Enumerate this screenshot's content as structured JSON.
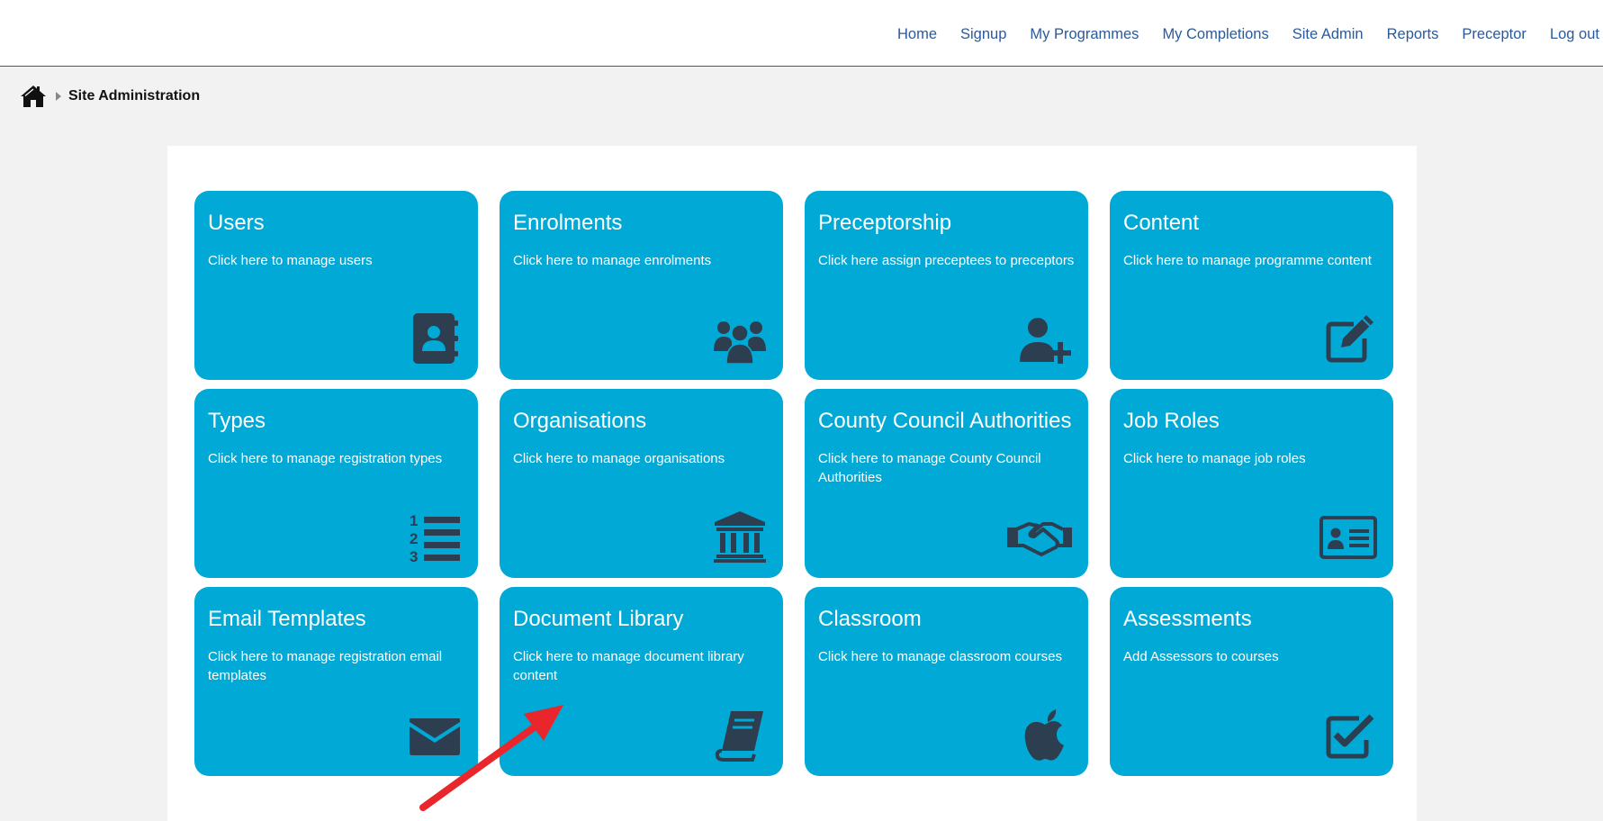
{
  "nav": {
    "items": [
      "Home",
      "Signup",
      "My Programmes",
      "My Completions",
      "Site Admin",
      "Reports",
      "Preceptor",
      "Log out"
    ]
  },
  "breadcrumb": {
    "current": "Site Administration",
    "home_icon": "home-icon"
  },
  "tiles": [
    {
      "title": "Users",
      "desc": "Click here to manage users",
      "icon": "address-book-icon"
    },
    {
      "title": "Enrolments",
      "desc": "Click here to manage enrolments",
      "icon": "users-group-icon"
    },
    {
      "title": "Preceptorship",
      "desc": "Click here assign preceptees to preceptors",
      "icon": "user-plus-icon"
    },
    {
      "title": "Content",
      "desc": "Click here to manage programme content",
      "icon": "edit-icon"
    },
    {
      "title": "Types",
      "desc": "Click here to manage registration types",
      "icon": "numbered-list-icon"
    },
    {
      "title": "Organisations",
      "desc": "Click here to manage organisations",
      "icon": "institution-icon"
    },
    {
      "title": "County Council Authorities",
      "desc": "Click here to manage County Council Authorities",
      "icon": "handshake-icon"
    },
    {
      "title": "Job Roles",
      "desc": "Click here to manage job roles",
      "icon": "id-card-icon"
    },
    {
      "title": "Email Templates",
      "desc": "Click here to manage registration email templates",
      "icon": "envelope-icon"
    },
    {
      "title": "Document Library",
      "desc": "Click here to manage document library content",
      "icon": "book-icon"
    },
    {
      "title": "Classroom",
      "desc": "Click here to manage classroom courses",
      "icon": "apple-icon"
    },
    {
      "title": "Assessments",
      "desc": "Add Assessors to courses",
      "icon": "check-square-icon"
    }
  ],
  "colors": {
    "tile": "#00a9d6",
    "icon": "#2d3e50",
    "nav_link": "#2a5a9a",
    "annotation_arrow": "#e8262b"
  }
}
